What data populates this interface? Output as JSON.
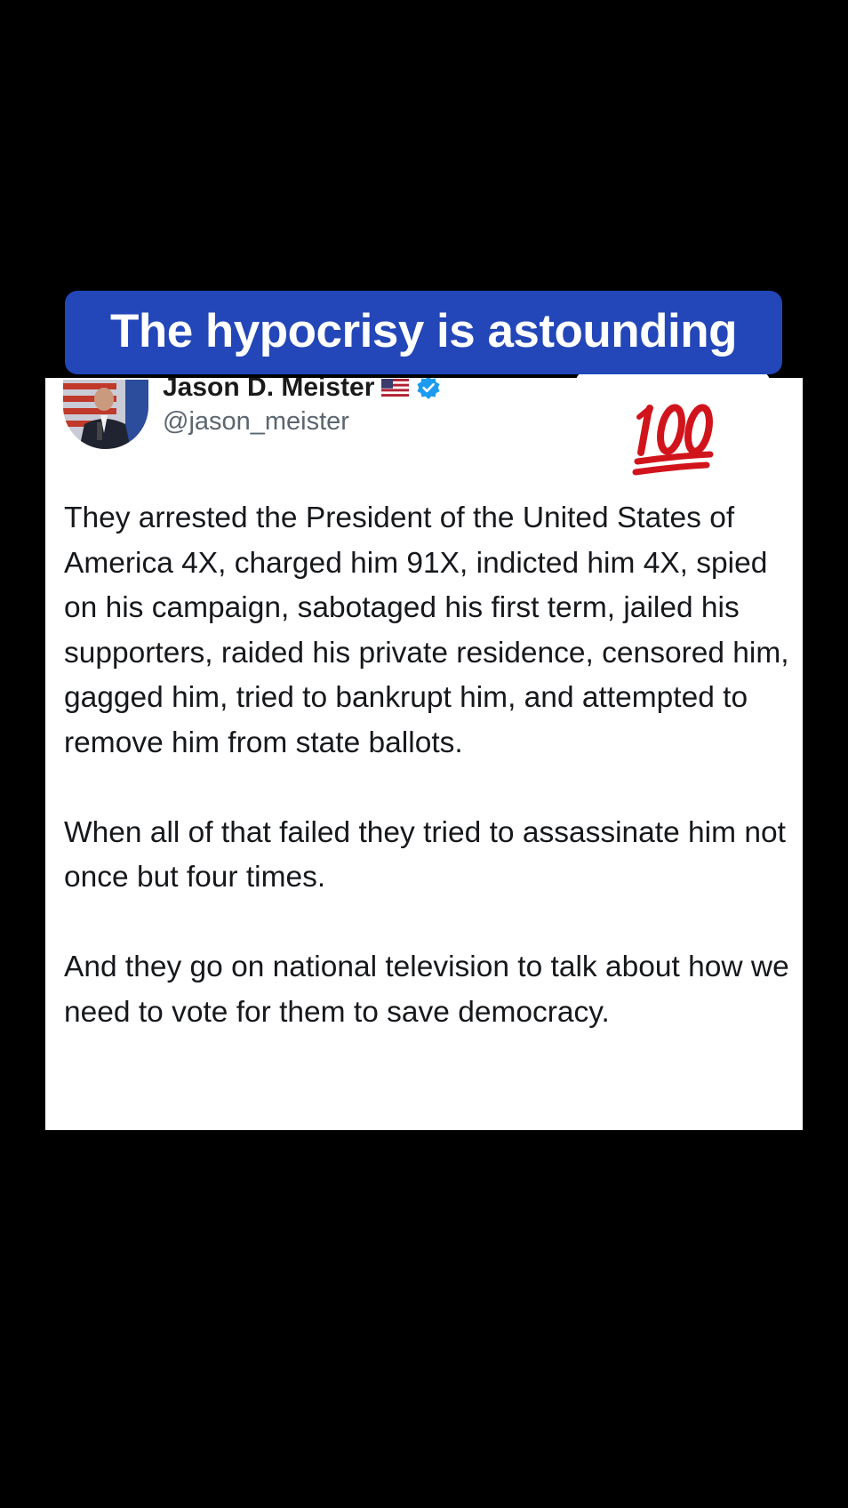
{
  "caption": {
    "text": "The hypocrisy is astounding",
    "background_color": "#2346b8"
  },
  "tweet": {
    "author": {
      "display_name": "Jason D. Meister",
      "handle": "@jason_meister",
      "flag_icon": "us-flag-icon",
      "verified_icon": "verified-badge-icon",
      "verified_color": "#1d9bf0"
    },
    "reaction_icon": "hundred-points-emoji",
    "paragraphs": [
      "They arrested the President of the United States of America 4X, charged him 91X, indicted him 4X, spied on his campaign, sabotaged his first term, jailed his supporters, raided his private residence, censored him, gagged him, tried to bankrupt him, and attempted to remove him from state ballots.",
      "When all of that failed they tried to assassinate him not once but four times.",
      "And they go on national television to talk about how we need to vote for them to save democracy."
    ]
  }
}
